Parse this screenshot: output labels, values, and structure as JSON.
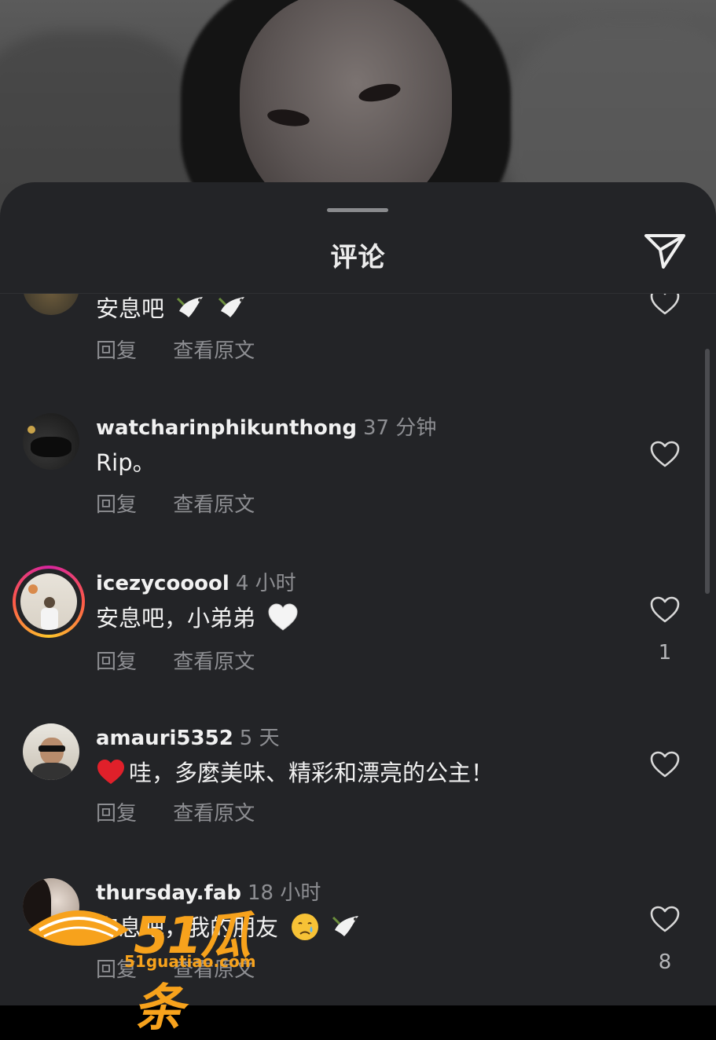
{
  "sheet": {
    "title": "评论"
  },
  "comments": [
    {
      "username": "",
      "time": "",
      "text": "安息吧",
      "reply_label": "回复",
      "translate_label": "查看原文",
      "likes": ""
    },
    {
      "username": "watcharinphikunthong",
      "time": "37 分钟",
      "text": "Rip。",
      "reply_label": "回复",
      "translate_label": "查看原文",
      "likes": ""
    },
    {
      "username": "icezycooool",
      "time": "4 小时",
      "text": "安息吧，小弟弟",
      "reply_label": "回复",
      "translate_label": "查看原文",
      "likes": "1"
    },
    {
      "username": "amauri5352",
      "time": "5 天",
      "text": "哇，多麼美味、精彩和漂亮的公主！",
      "reply_label": "回复",
      "translate_label": "查看原文",
      "likes": ""
    },
    {
      "username": "thursday.fab",
      "time": "18 小时",
      "text": "安息吧，我的朋友",
      "reply_label": "回复",
      "translate_label": "查看原文",
      "likes": "8"
    }
  ],
  "watermark": {
    "logo_text": "51瓜条",
    "url": "51guatiao.com"
  },
  "icons": {
    "send": "paper-plane-icon",
    "like": "heart-outline-icon",
    "dove": "dove-emoji",
    "heart_white": "white-heart-emoji",
    "heart_red": "red-heart-emoji",
    "crying": "crying-face-emoji"
  },
  "colors": {
    "sheet_bg": "#232427",
    "text_primary": "#f1f1f1",
    "text_secondary": "#8d8e92",
    "watermark": "#f7a21c"
  }
}
